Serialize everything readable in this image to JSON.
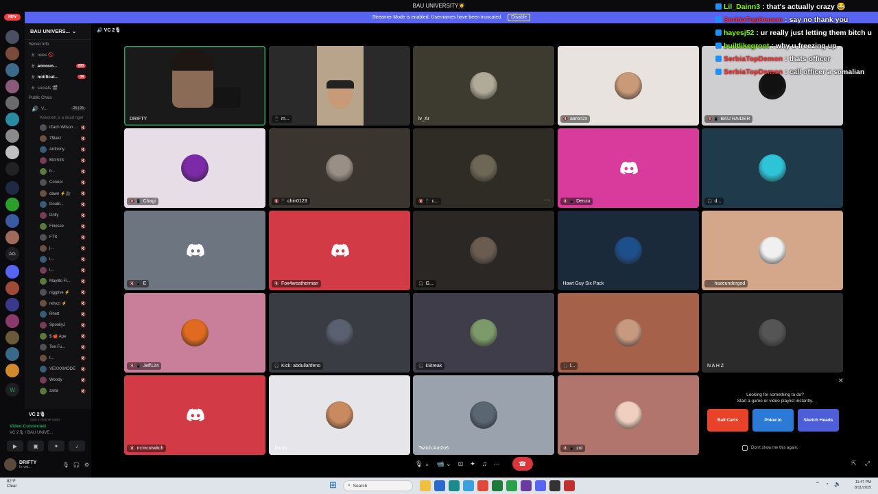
{
  "window": {
    "title": "BAU UNIVERSITY🧑‍🎓"
  },
  "banner": {
    "text": "Streamer Mode is enabled. Usernames have been truncated.",
    "button": "Disable"
  },
  "server": {
    "name": "BAU UNIVERS..."
  },
  "voice": {
    "channel": "VC 2🎙"
  },
  "channels": [
    {
      "name": "Server Info",
      "type": "cat"
    },
    {
      "name": "rules 🚫",
      "type": "ch"
    },
    {
      "name": "announ...",
      "type": "ch",
      "badge": "200",
      "bold": true
    },
    {
      "name": "notificat...",
      "type": "ch",
      "badge": "34",
      "bold": true
    },
    {
      "name": "socials 🎬",
      "type": "ch"
    },
    {
      "name": "Public Chats",
      "type": "cat"
    },
    {
      "name": "V...",
      "type": "voice",
      "counts": "25 | 25"
    }
  ],
  "channel_status": "Keeonen is a dead nger",
  "members": [
    "iZach Wilson ...",
    "7$takz",
    "Anthony",
    "BIGSIIX",
    "b...",
    "Connor",
    "dawn ⚡🎥",
    "Doubl...",
    "Drilly",
    "Finesse",
    "FTS",
    "j...",
    "i...",
    "i...",
    "Maylito Fl...",
    "niggtive ⚡",
    "rehxzi ⚡",
    "Rhett",
    "SpookyJ",
    "$ 🍎 Ape",
    "Tee Fu...",
    "t...",
    "VEXXXMODE",
    "Woody",
    "zarla"
  ],
  "vc_panel": {
    "channel_row": "VC 2🎙",
    "channel_sub": "Start a channel status",
    "status": "Video Connected",
    "sub": "VC 2🎙 / BAU UNIVE...",
    "user": "DRIFTY",
    "user_status": "In vid..."
  },
  "tiles": [
    {
      "name": "DRIFTY",
      "kind": "cam",
      "bg": "#1a1a1a",
      "speaking": true,
      "plain": true
    },
    {
      "name": "m...",
      "kind": "cam2",
      "bg": "#2a2a2a",
      "icons": "📱"
    },
    {
      "name": "lv_Ar",
      "kind": "avatar",
      "bg": "#3d3a30",
      "av": "#b0aa98",
      "plain": true
    },
    {
      "name": "aaron2x",
      "kind": "avatar",
      "bg": "#e8e3de",
      "av": "#c99a78",
      "icons": "🔇"
    },
    {
      "name": "BAU RAIDER",
      "kind": "avatar",
      "bg": "#cfcfd1",
      "av": "#111",
      "icons": "🔇 📱"
    },
    {
      "name": "Chagi",
      "kind": "avatar",
      "bg": "#e6dde6",
      "av": "#7d2aa8",
      "icons": "🔇 📱"
    },
    {
      "name": "chin0123",
      "kind": "avatar",
      "bg": "#3b3530",
      "av": "#9a8f86",
      "icons": "🔇 📱"
    },
    {
      "name": "c...",
      "kind": "avatar",
      "bg": "#2f2c25",
      "av": "#6d6755",
      "icons": "🔇 📱",
      "more": true
    },
    {
      "name": "Denzo",
      "kind": "discord",
      "bg": "#d93b9c",
      "icons": "🔇 📱"
    },
    {
      "name": "d...",
      "kind": "avatar",
      "bg": "#1f3a4a",
      "av": "#2ec4d8",
      "icons": "🎧"
    },
    {
      "name": "E",
      "kind": "discord",
      "bg": "#6d7580",
      "icons": "🔇 📱"
    },
    {
      "name": "Fox4weatherman",
      "kind": "discord",
      "bg": "#d23a46",
      "icons": "🔇"
    },
    {
      "name": "G...",
      "kind": "avatar",
      "bg": "#2a2725",
      "av": "#6a5c50",
      "icons": "🎧"
    },
    {
      "name": "Hawt Guy Six Pack",
      "kind": "avatar",
      "bg": "#1b2a3a",
      "av": "#1d4f8a",
      "plain": true
    },
    {
      "name": "hazeundergod",
      "kind": "avatar",
      "bg": "#d4a78a",
      "av": "#f0f0f0",
      "icons": "🎧"
    },
    {
      "name": "Jeff124",
      "kind": "avatar",
      "bg": "#c97f9a",
      "av": "#e06a20",
      "icons": "🔇 📱"
    },
    {
      "name": "Kick: abdullahfeno",
      "kind": "avatar",
      "bg": "#3a3c44",
      "av": "#5a6070",
      "icons": "🎧"
    },
    {
      "name": "kStreak",
      "kind": "avatar",
      "bg": "#3f3d49",
      "av": "#7d9a6a",
      "icons": "🎧"
    },
    {
      "name": "l...",
      "kind": "avatar",
      "bg": "#a5614a",
      "av": "#c79a80",
      "icons": "🎧"
    },
    {
      "name": "N A H Z",
      "kind": "avatar",
      "bg": "#2b2b2b",
      "av": "#555",
      "plain": true
    },
    {
      "name": "rrcincotwitch",
      "kind": "discord",
      "bg": "#d23a46",
      "icons": "🔇"
    },
    {
      "name": "Tacoh",
      "kind": "avatar",
      "bg": "#e6e6ea",
      "av": "#c98a60",
      "plain": true
    },
    {
      "name": "Twitch:Am2o6",
      "kind": "avatar",
      "bg": "#9aa3ad",
      "av": "#5a6672",
      "plain": true
    },
    {
      "name": "zol",
      "kind": "avatar",
      "bg": "#b1756e",
      "av": "#f0cfc0",
      "icons": "🔇 📱"
    }
  ],
  "promo": {
    "title": "Looking for something to do?",
    "subtitle": "Start a game or video playlist instantly.",
    "checkbox": "Don't show me this again.",
    "cards": [
      {
        "label": "Ball Carts",
        "color": "#e8432a"
      },
      {
        "label": "Poker.io",
        "color": "#2b7bd6"
      },
      {
        "label": "Sketch Heads",
        "color": "#4c5fd8"
      }
    ]
  },
  "chat": [
    {
      "user": "Lil_Dainn3",
      "msg": ": that's actually crazy 😂",
      "red": false
    },
    {
      "user": "SerbiaTopDemon",
      "msg": ": say no thank you",
      "red": true
    },
    {
      "user": "hayesj52",
      "msg": ": ur really just letting them bitch u",
      "red": false
    },
    {
      "user": "builtlikegroot",
      "msg": ": why u freezing up",
      "red": false
    },
    {
      "user": "SerbiaTopDemon",
      "msg": ": thats officer",
      "red": true
    },
    {
      "user": "SerbiaTopDemon",
      "msg": ": call officer a somalian",
      "red": true
    }
  ],
  "taskbar": {
    "temp": "82°F",
    "weather": "Clear",
    "search": "Search",
    "time": "11:47 PM",
    "date": "8/11/2025"
  },
  "colors": {
    "accent": "#5865f2",
    "online": "#23a55a",
    "danger": "#da373c"
  }
}
